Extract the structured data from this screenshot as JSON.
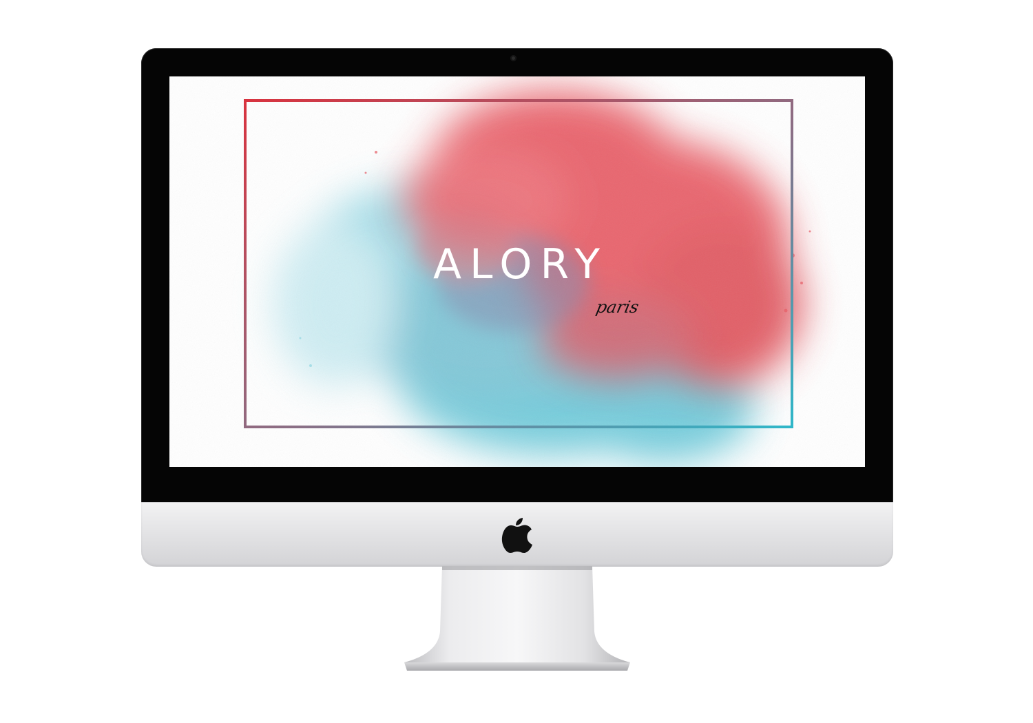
{
  "screen": {
    "brand_name": "ALORY",
    "brand_tagline": "paris"
  },
  "colors": {
    "coral": "#e85a63",
    "aqua": "#5ec4d6",
    "frame_start": "#d8333f",
    "frame_end": "#2fb7c9",
    "bezel": "#050505",
    "aluminum": "#e4e4e6"
  },
  "icons": {
    "logo": "apple-logo-icon",
    "camera": "camera-icon"
  }
}
